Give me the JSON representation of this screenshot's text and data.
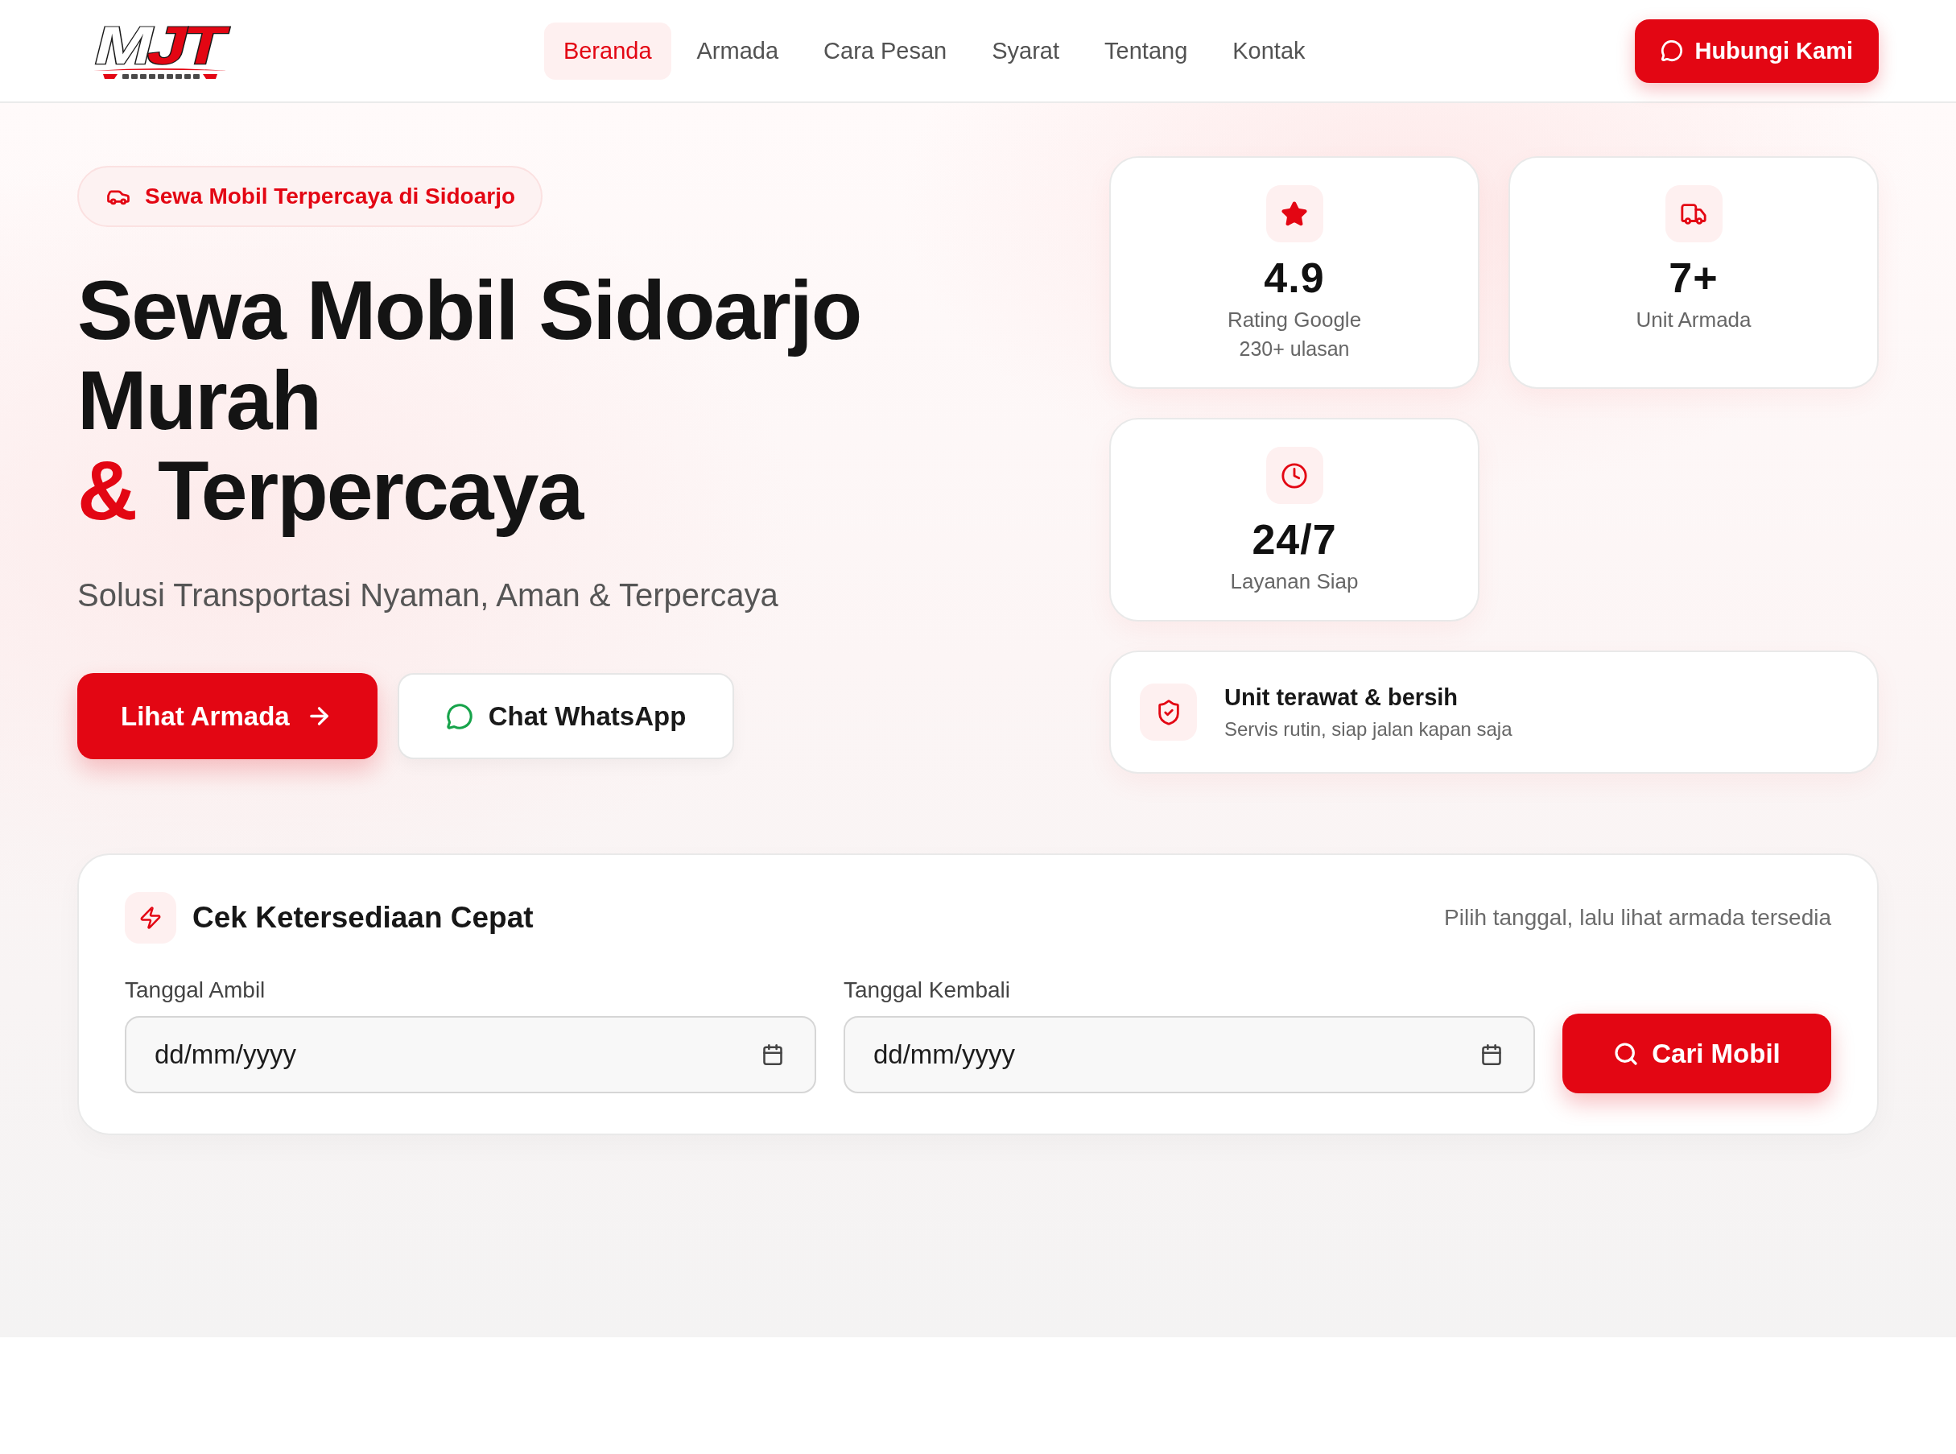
{
  "header": {
    "logo": {
      "parts": [
        {
          "text": "M",
          "color": "#ffffff"
        },
        {
          "text": "JT",
          "color": "#e30613"
        }
      ]
    },
    "nav": [
      {
        "label": "Beranda",
        "selected": true
      },
      {
        "label": "Armada",
        "selected": false
      },
      {
        "label": "Cara Pesan",
        "selected": false
      },
      {
        "label": "Syarat",
        "selected": false
      },
      {
        "label": "Tentang",
        "selected": false
      },
      {
        "label": "Kontak",
        "selected": false
      }
    ],
    "cta": "Hubungi Kami"
  },
  "hero": {
    "badge": "Sewa Mobil Terpercaya di Sidoarjo",
    "heading": {
      "lines": [
        {
          "text": "Sewa Mobil Sidoarjo"
        },
        {
          "text": "Murah"
        },
        {
          "accent": "&",
          "text": "Terpercaya"
        }
      ]
    },
    "subtitle": "Solusi Transportasi Nyaman, Aman & Terpercaya",
    "buttons": [
      {
        "label": "Lihat Armada",
        "kind": "primary"
      },
      {
        "label": "Chat WhatsApp",
        "kind": "outline"
      }
    ],
    "stats": [
      {
        "value": "4.9",
        "label": "Rating Google",
        "note": "230+ ulasan"
      },
      {
        "value": "7+",
        "label": "Unit Armada"
      },
      {
        "value": "24/7",
        "label": "Layanan Siap"
      }
    ],
    "feature": {
      "title": "Unit terawat & bersih",
      "text": "Servis rutin, siap jalan kapan saja"
    }
  },
  "availability": {
    "title": "Cek Ketersediaan Cepat",
    "hint": "Pilih tanggal, lalu lihat armada tersedia",
    "fields": [
      {
        "label": "Tanggal Ambil",
        "placeholder": "dd/mm/yyyy"
      },
      {
        "label": "Tanggal Kembali",
        "placeholder": "dd/mm/yyyy"
      }
    ],
    "button": "Cari Mobil"
  }
}
